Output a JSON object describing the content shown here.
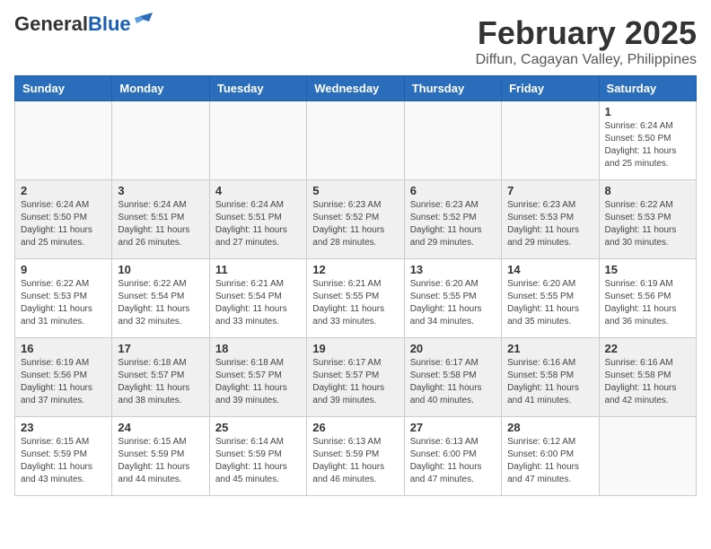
{
  "header": {
    "logo_general": "General",
    "logo_blue": "Blue",
    "month_year": "February 2025",
    "location": "Diffun, Cagayan Valley, Philippines"
  },
  "weekdays": [
    "Sunday",
    "Monday",
    "Tuesday",
    "Wednesday",
    "Thursday",
    "Friday",
    "Saturday"
  ],
  "weeks": [
    [
      {
        "day": "",
        "info": ""
      },
      {
        "day": "",
        "info": ""
      },
      {
        "day": "",
        "info": ""
      },
      {
        "day": "",
        "info": ""
      },
      {
        "day": "",
        "info": ""
      },
      {
        "day": "",
        "info": ""
      },
      {
        "day": "1",
        "info": "Sunrise: 6:24 AM\nSunset: 5:50 PM\nDaylight: 11 hours\nand 25 minutes."
      }
    ],
    [
      {
        "day": "2",
        "info": "Sunrise: 6:24 AM\nSunset: 5:50 PM\nDaylight: 11 hours\nand 25 minutes."
      },
      {
        "day": "3",
        "info": "Sunrise: 6:24 AM\nSunset: 5:51 PM\nDaylight: 11 hours\nand 26 minutes."
      },
      {
        "day": "4",
        "info": "Sunrise: 6:24 AM\nSunset: 5:51 PM\nDaylight: 11 hours\nand 27 minutes."
      },
      {
        "day": "5",
        "info": "Sunrise: 6:23 AM\nSunset: 5:52 PM\nDaylight: 11 hours\nand 28 minutes."
      },
      {
        "day": "6",
        "info": "Sunrise: 6:23 AM\nSunset: 5:52 PM\nDaylight: 11 hours\nand 29 minutes."
      },
      {
        "day": "7",
        "info": "Sunrise: 6:23 AM\nSunset: 5:53 PM\nDaylight: 11 hours\nand 29 minutes."
      },
      {
        "day": "8",
        "info": "Sunrise: 6:22 AM\nSunset: 5:53 PM\nDaylight: 11 hours\nand 30 minutes."
      }
    ],
    [
      {
        "day": "9",
        "info": "Sunrise: 6:22 AM\nSunset: 5:53 PM\nDaylight: 11 hours\nand 31 minutes."
      },
      {
        "day": "10",
        "info": "Sunrise: 6:22 AM\nSunset: 5:54 PM\nDaylight: 11 hours\nand 32 minutes."
      },
      {
        "day": "11",
        "info": "Sunrise: 6:21 AM\nSunset: 5:54 PM\nDaylight: 11 hours\nand 33 minutes."
      },
      {
        "day": "12",
        "info": "Sunrise: 6:21 AM\nSunset: 5:55 PM\nDaylight: 11 hours\nand 33 minutes."
      },
      {
        "day": "13",
        "info": "Sunrise: 6:20 AM\nSunset: 5:55 PM\nDaylight: 11 hours\nand 34 minutes."
      },
      {
        "day": "14",
        "info": "Sunrise: 6:20 AM\nSunset: 5:55 PM\nDaylight: 11 hours\nand 35 minutes."
      },
      {
        "day": "15",
        "info": "Sunrise: 6:19 AM\nSunset: 5:56 PM\nDaylight: 11 hours\nand 36 minutes."
      }
    ],
    [
      {
        "day": "16",
        "info": "Sunrise: 6:19 AM\nSunset: 5:56 PM\nDaylight: 11 hours\nand 37 minutes."
      },
      {
        "day": "17",
        "info": "Sunrise: 6:18 AM\nSunset: 5:57 PM\nDaylight: 11 hours\nand 38 minutes."
      },
      {
        "day": "18",
        "info": "Sunrise: 6:18 AM\nSunset: 5:57 PM\nDaylight: 11 hours\nand 39 minutes."
      },
      {
        "day": "19",
        "info": "Sunrise: 6:17 AM\nSunset: 5:57 PM\nDaylight: 11 hours\nand 39 minutes."
      },
      {
        "day": "20",
        "info": "Sunrise: 6:17 AM\nSunset: 5:58 PM\nDaylight: 11 hours\nand 40 minutes."
      },
      {
        "day": "21",
        "info": "Sunrise: 6:16 AM\nSunset: 5:58 PM\nDaylight: 11 hours\nand 41 minutes."
      },
      {
        "day": "22",
        "info": "Sunrise: 6:16 AM\nSunset: 5:58 PM\nDaylight: 11 hours\nand 42 minutes."
      }
    ],
    [
      {
        "day": "23",
        "info": "Sunrise: 6:15 AM\nSunset: 5:59 PM\nDaylight: 11 hours\nand 43 minutes."
      },
      {
        "day": "24",
        "info": "Sunrise: 6:15 AM\nSunset: 5:59 PM\nDaylight: 11 hours\nand 44 minutes."
      },
      {
        "day": "25",
        "info": "Sunrise: 6:14 AM\nSunset: 5:59 PM\nDaylight: 11 hours\nand 45 minutes."
      },
      {
        "day": "26",
        "info": "Sunrise: 6:13 AM\nSunset: 5:59 PM\nDaylight: 11 hours\nand 46 minutes."
      },
      {
        "day": "27",
        "info": "Sunrise: 6:13 AM\nSunset: 6:00 PM\nDaylight: 11 hours\nand 47 minutes."
      },
      {
        "day": "28",
        "info": "Sunrise: 6:12 AM\nSunset: 6:00 PM\nDaylight: 11 hours\nand 47 minutes."
      },
      {
        "day": "",
        "info": ""
      }
    ]
  ]
}
